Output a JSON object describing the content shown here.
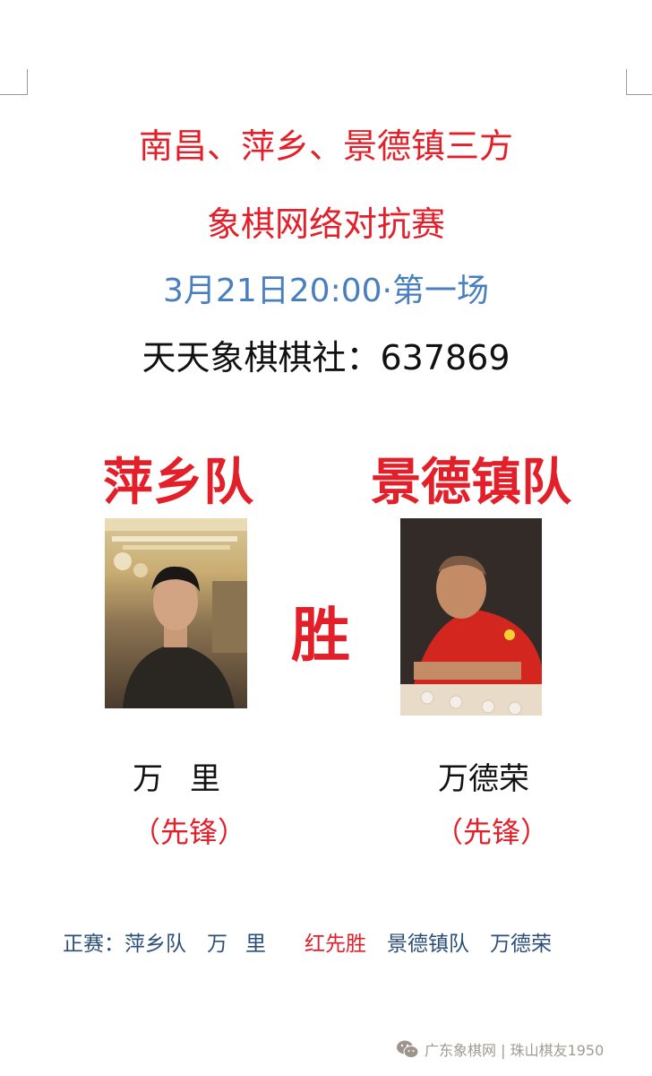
{
  "header": {
    "title_line1": "南昌、萍乡、景德镇三方",
    "title_line2": "象棋网络对抗赛",
    "subtitle": "3月21日20:00·第一场",
    "club": "天天象棋棋社：637869"
  },
  "match": {
    "left_team": "萍乡队",
    "right_team": "景德镇队",
    "result": "胜",
    "left_player": "万里",
    "right_player": "万德荣",
    "left_role": "（先锋）",
    "right_role": "（先锋）"
  },
  "footer": {
    "label": "正赛：",
    "left_team": "萍乡队",
    "left_player": "万里",
    "result": "红先胜",
    "right_team": "景德镇队",
    "right_player": "万德荣"
  },
  "watermark": {
    "icon": "wechat-icon",
    "text": "广东象棋网 | 珠山棋友1950"
  },
  "colors": {
    "accent_red": "#e3202a",
    "subtitle_blue": "#4a7fbe",
    "footer_blue": "#2b4f78"
  }
}
